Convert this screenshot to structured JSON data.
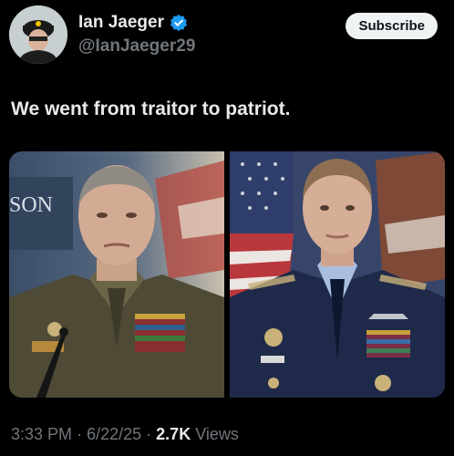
{
  "author": {
    "display_name": "Ian Jaeger",
    "handle": "@IanJaeger29",
    "verified": true,
    "accent": "#1d9bf0"
  },
  "actions": {
    "subscribe_label": "Subscribe"
  },
  "tweet": {
    "text": "We went from traitor to patriot."
  },
  "media": {
    "left_photo_sign_text": "SON",
    "count": 2
  },
  "meta": {
    "time": "3:33 PM",
    "separator": "·",
    "date": "6/22/25",
    "views_count": "2.7K",
    "views_label": "Views"
  }
}
